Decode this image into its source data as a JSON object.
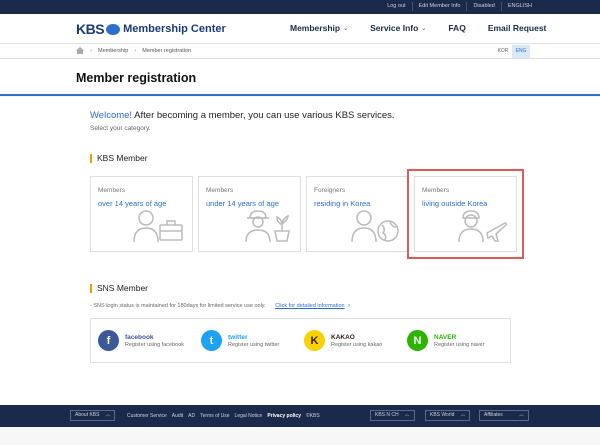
{
  "utility": {
    "links": [
      "Log out",
      "Edit Member Info",
      "Disabled",
      "ENGLISH"
    ]
  },
  "header": {
    "logo_kbs": "KBS",
    "logo_text": "Membership Center",
    "nav": [
      {
        "label": "Membership",
        "has_dropdown": true
      },
      {
        "label": "Service Info",
        "has_dropdown": true
      },
      {
        "label": "FAQ",
        "has_dropdown": false
      },
      {
        "label": "Email Request",
        "has_dropdown": false
      }
    ]
  },
  "breadcrumb": {
    "items": [
      "Membership",
      "Member registration"
    ],
    "languages": {
      "kor": "KOR",
      "eng": "ENG",
      "active": "ENG"
    }
  },
  "page": {
    "title": "Member registration"
  },
  "intro": {
    "welcome_highlight": "Welcome!",
    "welcome_rest": " After becoming a member, you can use various KBS services.",
    "subtitle": "Select your category."
  },
  "kbs_member": {
    "title": "KBS Member",
    "cards": [
      {
        "label": "Members",
        "desc": "over 14 years of age",
        "icon": "adult-member-icon"
      },
      {
        "label": "Members",
        "desc": "under 14 years of age",
        "icon": "child-member-icon"
      },
      {
        "label": "Foreigners",
        "desc": "residing in Korea",
        "icon": "foreigner-globe-icon"
      },
      {
        "label": "Members",
        "desc": "living outside Korea",
        "icon": "overseas-member-icon"
      }
    ]
  },
  "sns_member": {
    "title": "SNS Member",
    "note": "- SNS login status is maintained for 180days for limited service use only.",
    "note_link": "Click for detailed information",
    "providers": [
      {
        "name": "facebook",
        "desc": "Register using facebook",
        "color": "#3b5998",
        "glyph": "f",
        "name_color": "#3b5998"
      },
      {
        "name": "twitter",
        "desc": "Register using twitter",
        "color": "#1da1f2",
        "glyph": "t",
        "name_color": "#1da1f2"
      },
      {
        "name": "KAKAO",
        "desc": "Register using kakao",
        "color": "#f7d100",
        "glyph": "K",
        "name_color": "#3a1d1d"
      },
      {
        "name": "NAVER",
        "desc": "Register using naver",
        "color": "#2db400",
        "glyph": "N",
        "name_color": "#2db400"
      }
    ]
  },
  "footer": {
    "about": "About KBS",
    "links": [
      "Customer Service",
      "Audit",
      "AD",
      "Terms of Use",
      "Legal Notice",
      "Privacy policy",
      "©KBS"
    ],
    "bold_link": "Privacy policy",
    "selects": [
      "KBS N CH",
      "KBS World",
      "Affiliates"
    ]
  },
  "colors": {
    "accent": "#2d6fd1",
    "navy": "#1b2a4a",
    "section_bar": "#f29b00",
    "selected_outline": "#e05a5a"
  }
}
